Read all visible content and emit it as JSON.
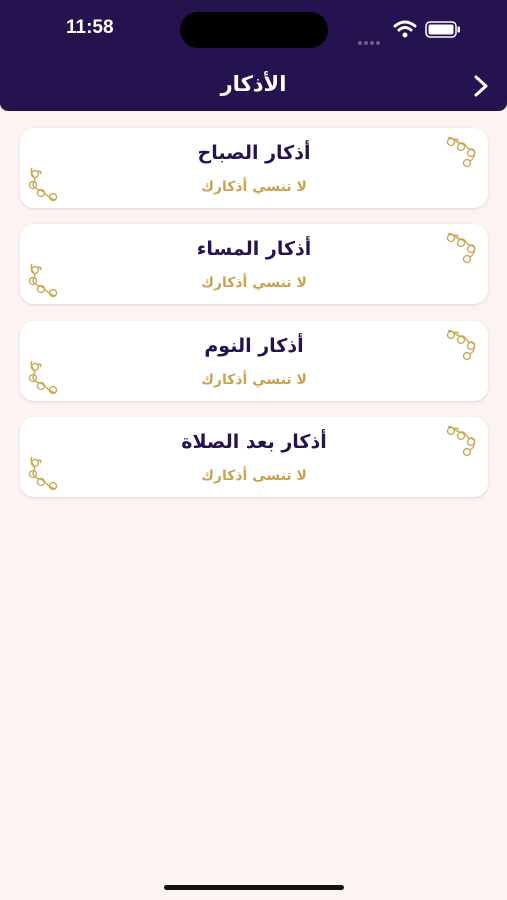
{
  "status_bar": {
    "time": "11:58"
  },
  "header": {
    "title": "الأذكار"
  },
  "items": [
    {
      "title": "أذكار الصباح",
      "subtitle": "لا تنسي أذكارك"
    },
    {
      "title": "أذكار المساء",
      "subtitle": "لا تنسي أذكارك"
    },
    {
      "title": "أذكار النوم",
      "subtitle": "لا تنسي أذكارك"
    },
    {
      "title": "أذكار بعد الصلاة",
      "subtitle": "لا تنسى أذكارك"
    }
  ],
  "colors": {
    "header_bg": "#25134f",
    "page_bg": "#fcf4f1",
    "title_text": "#25134f",
    "accent_gold": "#c9a34f"
  },
  "icons": {
    "back": "chevron-right-icon",
    "ornament": "floral-ornament-icon"
  }
}
